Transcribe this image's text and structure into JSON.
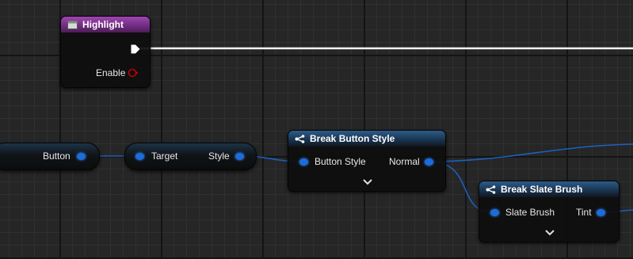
{
  "highlight_node": {
    "title": "Highlight",
    "enable_label": "Enable"
  },
  "button_node": {
    "output_label": "Button"
  },
  "target_node": {
    "input_label": "Target",
    "output_label": "Style"
  },
  "break_button_style": {
    "title": "Break Button Style",
    "input_label": "Button Style",
    "output_label": "Normal"
  },
  "break_slate_brush": {
    "title": "Break Slate Brush",
    "input_label": "Slate Brush",
    "output_label": "Tint"
  },
  "icons": [
    "widget-icon",
    "exec-pin-icon",
    "bool-pin-icon",
    "break-struct-icon",
    "chevron-down-icon"
  ],
  "colors": {
    "struct_pin": "#1a6ddb",
    "bool_pin": "#b00000",
    "exec_wire": "#ffffff",
    "function_header": "#7d2f8e"
  }
}
